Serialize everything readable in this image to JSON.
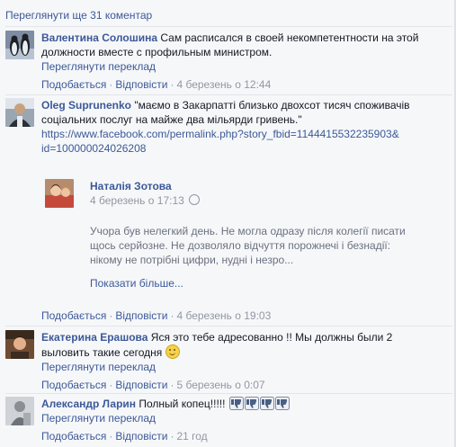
{
  "more_comments_link": "Переглянути ще 31 коментар",
  "comments": [
    {
      "author": "Валентина Солошина",
      "text_line1": "Сам расписался в своей некомпетентности на этой",
      "text_line2": "должности вместе с профильным министром.",
      "translate": "Переглянути переклад",
      "like": "Подобається",
      "reply": "Відповісти",
      "time": "4 березень о 12:44",
      "avatar_icon": "penguin-avatar-icon"
    },
    {
      "author": "Oleg Suprunenko",
      "text_line1": "\"маємо в Закарпатті близько двохсот тисяч споживачів",
      "text_line2": "соціальних послуг на майже два мільярди гривень.\"",
      "url_line1": "https://www.facebook.com/permalink.php?story_fbid=1144415532235903&",
      "url_line2": "id=100000024026208",
      "like": "Подобається",
      "reply": "Відповісти",
      "time": "4 березень о 19:03",
      "avatar_icon": "man-avatar-icon",
      "shared_post": {
        "author": "Наталія Зотова",
        "time": "4 березень о 17:13",
        "text_line1": "Учора був нелегкий день. Не могла одразу після колегії писати",
        "text_line2": "щось серйозне. Не дозволяло відчуття порожнечі і безнадії:",
        "text_line3": "нікому не потрібні цифри, нудні і незро...",
        "show_more": "Показати більше...",
        "avatar_icon": "woman-avatar-icon"
      }
    },
    {
      "author": "Екатерина Ерашова",
      "text_line1": "Яся это тебе адресованно !! Мы должны были 2",
      "text_line2": "выловить такие сегодня",
      "translate": "Переглянути переклад",
      "like": "Подобається",
      "reply": "Відповісти",
      "time": "5 березень о 0:07",
      "avatar_icon": "woman-avatar-icon"
    },
    {
      "author": "Александр Ларин",
      "text_line1": "Полный копец!!!!!",
      "translate": "Переглянути переклад",
      "like": "Подобається",
      "reply": "Відповісти",
      "time": "21 год",
      "avatar_icon": "man-avatar-icon",
      "thumbs_down_count": 4
    }
  ],
  "colors": {
    "link": "#3b5998",
    "meta": "#9197a3",
    "background": "#f6f7f9"
  }
}
